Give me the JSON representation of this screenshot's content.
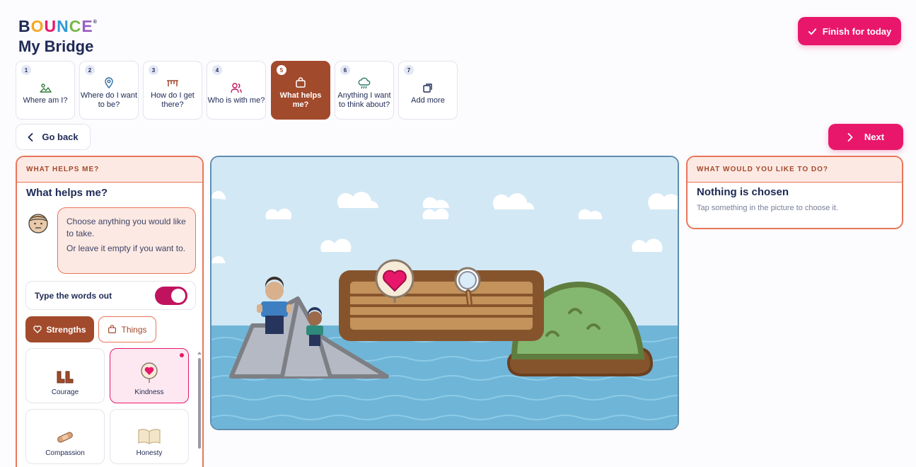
{
  "brand": {
    "logo_letters": [
      "B",
      "O",
      "U",
      "N",
      "C",
      "E"
    ],
    "logo_colors": [
      "#1e2a55",
      "#f5a623",
      "#e8176b",
      "#2f9bd6",
      "#7ab648",
      "#9b5fc0"
    ],
    "trademark": "®",
    "title": "My Bridge"
  },
  "header": {
    "finish_label": "Finish for today",
    "finish_icon": "check-icon"
  },
  "steps": [
    {
      "num": "1",
      "label": "Where am I?",
      "icon": "landscape-icon"
    },
    {
      "num": "2",
      "label": "Where do I want to be?",
      "icon": "location-pin-icon"
    },
    {
      "num": "3",
      "label": "How do I get there?",
      "icon": "bridge-icon"
    },
    {
      "num": "4",
      "label": "Who is with me?",
      "icon": "people-icon"
    },
    {
      "num": "5",
      "label": "What helps me?",
      "icon": "bag-icon",
      "active": true
    },
    {
      "num": "6",
      "label": "Anything I want to think about?",
      "icon": "cloud-rain-icon"
    },
    {
      "num": "7",
      "label": "Add more",
      "icon": "copy-icon"
    }
  ],
  "nav": {
    "back_label": "Go back",
    "next_label": "Next"
  },
  "left_panel": {
    "header": "WHAT HELPS ME?",
    "title": "What helps me?",
    "bubble_line1": "Choose anything you would like to take.",
    "bubble_line2": "Or leave it empty if you want to.",
    "toggle_label": "Type the words out",
    "toggle_on": true,
    "tab_strengths": "Strengths",
    "tab_things": "Things",
    "cards": [
      {
        "label": "Courage",
        "icon": "boots-icon"
      },
      {
        "label": "Kindness",
        "icon": "heart-badge-icon",
        "selected": true
      },
      {
        "label": "Compassion",
        "icon": "bandage-icon"
      },
      {
        "label": "Honesty",
        "icon": "open-book-icon"
      }
    ]
  },
  "right_panel": {
    "header": "WHAT WOULD YOU LIKE TO DO?",
    "title": "Nothing is chosen",
    "subtitle": "Tap something in the picture to choose it."
  },
  "colors": {
    "accent_pink": "#e8176b",
    "active_brown": "#a24a2c",
    "panel_border": "#e8765a",
    "panel_tint": "#fde9e3"
  }
}
